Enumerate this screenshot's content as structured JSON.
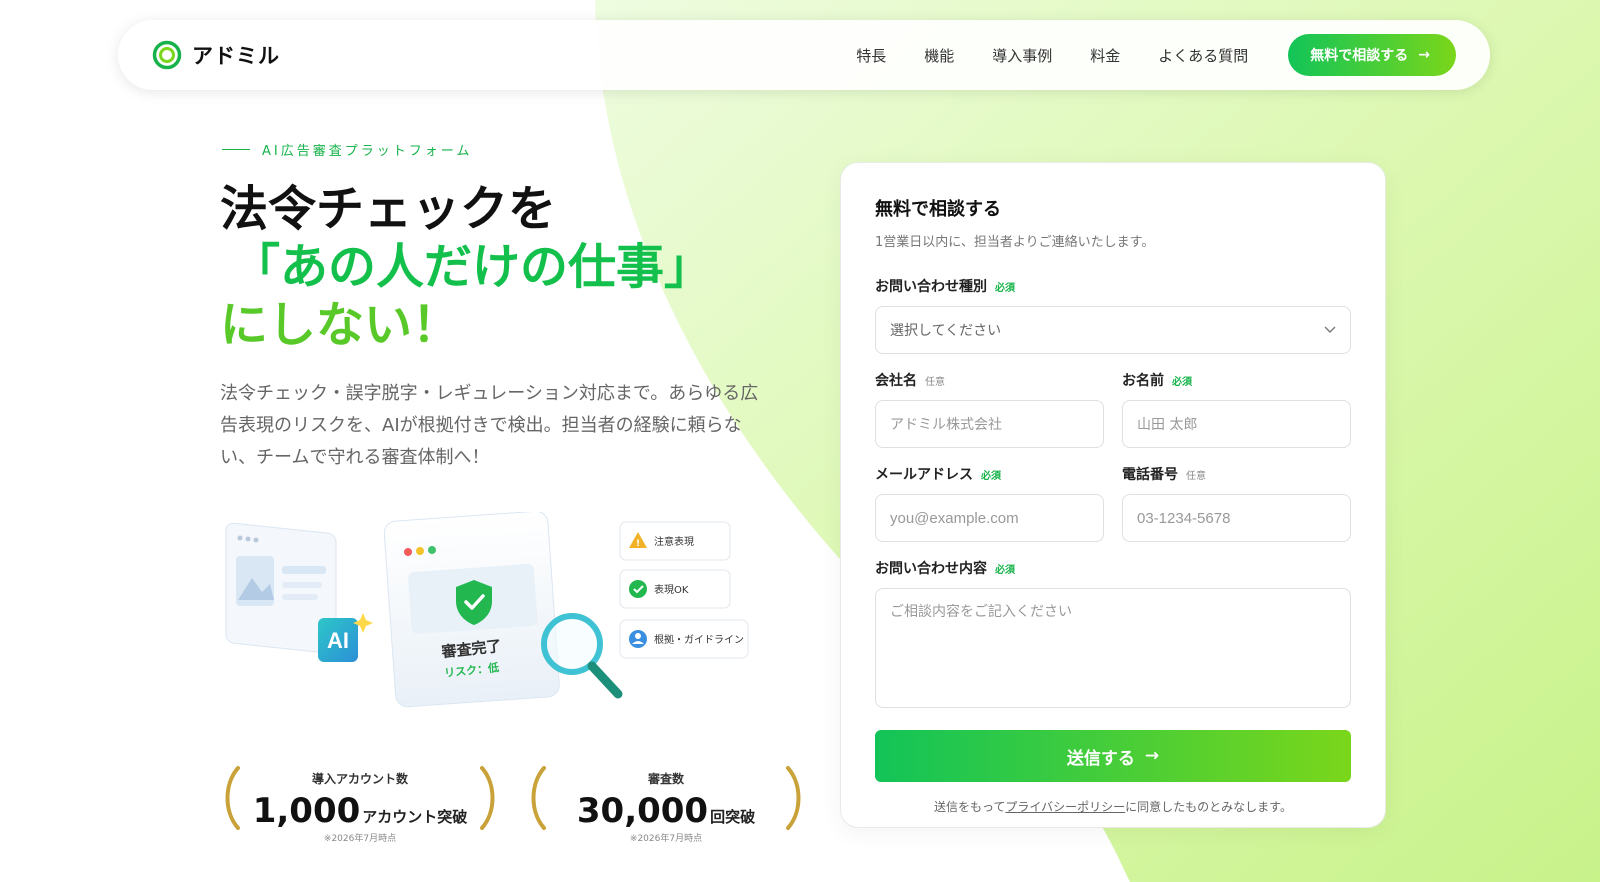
{
  "colors": {
    "accent": "#12c458",
    "accent2": "#7ad61a",
    "bg_green": "#dff7b8"
  },
  "header": {
    "logo_text": "アドミル",
    "nav": [
      "特長",
      "機能",
      "導入事例",
      "料金",
      "よくある質問"
    ],
    "cta_label": "無料で相談する"
  },
  "hero": {
    "eyebrow": "AI広告審査プラットフォーム",
    "headline_1": "法令チェックを",
    "headline_2": "「あの人だけの仕事」",
    "headline_3": "にしない！",
    "description": "法令チェック・誤字脱字・レギュレーション対応まで。あらゆる広告表現のリスクを、AIが根拠付きで検出。担当者の経験に頼らない、チームで守れる審査体制へ！"
  },
  "illustration": {
    "ai_badge": "AI",
    "review_done": "審査完了",
    "risk": "リスク：低",
    "tags": [
      "注意表現",
      "表現OK",
      "根拠・ガイドライン"
    ]
  },
  "stats": [
    {
      "label": "導入アカウント数",
      "value": "1,000",
      "unit": "アカウント突破",
      "note": "※2026年7月時点"
    },
    {
      "label": "審査数",
      "value": "30,000",
      "unit": "回突破",
      "note": "※2026年7月時点"
    }
  ],
  "form": {
    "title": "無料で相談する",
    "subtitle": "1営業日以内に、担当者よりご連絡いたします。",
    "required": "必須",
    "optional": "任意",
    "inquiry_type_label": "お問い合わせ種別",
    "inquiry_type_value": "選択してください",
    "company_label": "会社名",
    "company_placeholder": "アドミル株式会社",
    "name_label": "お名前",
    "name_placeholder": "山田 太郎",
    "email_label": "メールアドレス",
    "email_placeholder": "you@example.com",
    "phone_label": "電話番号",
    "phone_placeholder": "03-1234-5678",
    "message_label": "お問い合わせ内容",
    "message_placeholder": "ご相談内容をご記入ください",
    "submit_label": "送信する",
    "agree_prefix": "送信をもって",
    "agree_link": "プライバシーポリシー",
    "agree_suffix": "に同意したものとみなします。"
  }
}
